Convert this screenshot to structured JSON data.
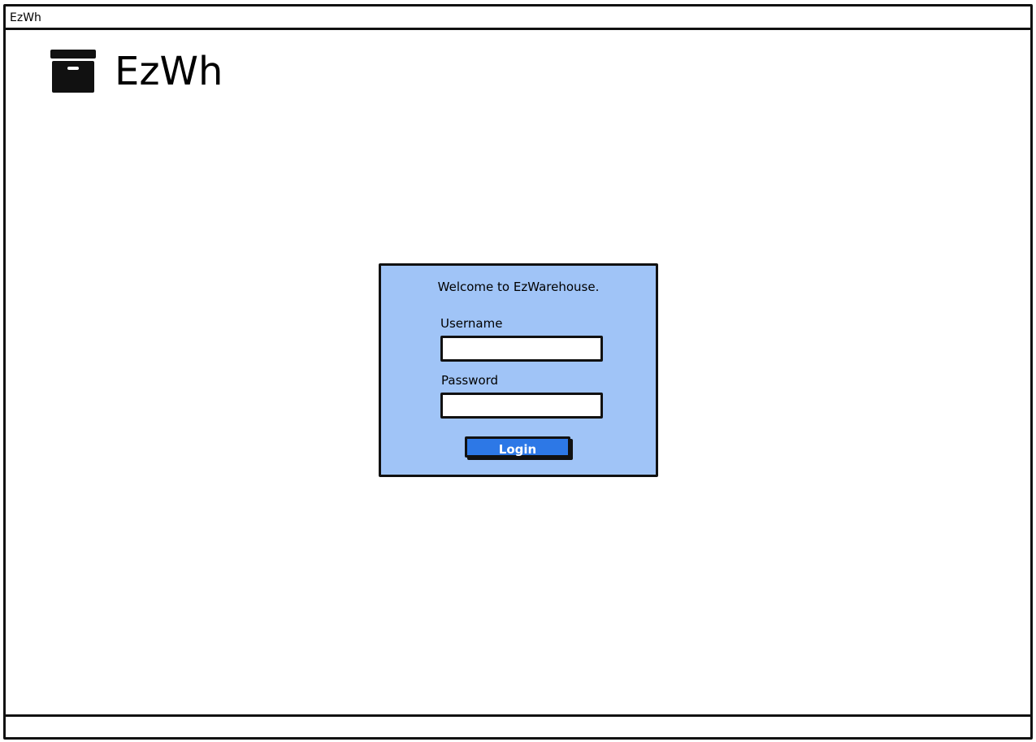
{
  "window": {
    "title": "EzWh"
  },
  "header": {
    "logo_icon": "archive-box-icon",
    "logo_text": "EzWh"
  },
  "login": {
    "welcome_text": "Welcome to EzWarehouse.",
    "username_label": "Username",
    "username_value": "",
    "password_label": "Password",
    "password_value": "",
    "login_button_label": "Login"
  },
  "colors": {
    "panel_background": "#a0c4f7",
    "button_background": "#2d78e6",
    "border": "#111111"
  }
}
